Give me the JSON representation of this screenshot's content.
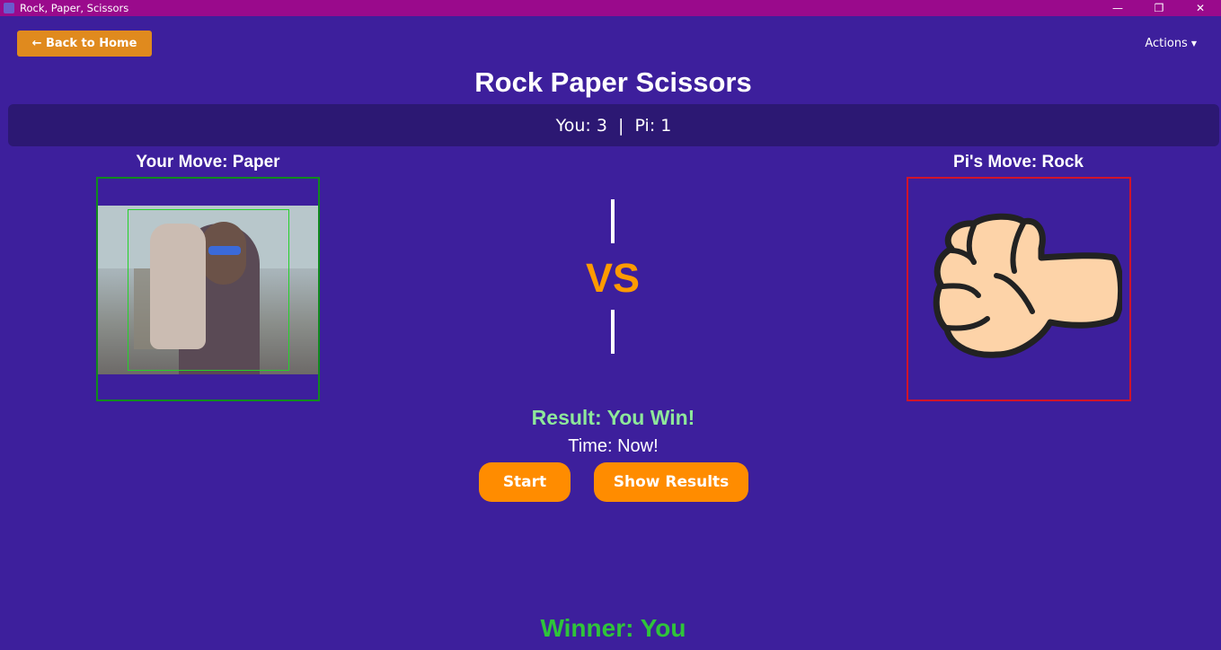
{
  "window": {
    "title": "Rock, Paper, Scissors",
    "controls": {
      "minimize": "—",
      "restore": "❐",
      "close": "✕"
    }
  },
  "header": {
    "back_label": "← Back to Home",
    "actions_label": "Actions",
    "actions_caret": "▼"
  },
  "page_title": "Rock Paper Scissors",
  "score": {
    "text": "You: 3  |  Pi: 1",
    "you": 3,
    "pi": 1
  },
  "player": {
    "move_label": "Your Move: Paper",
    "frame_color": "#118a1e"
  },
  "pi": {
    "move_label": "Pi's Move: Rock",
    "frame_color": "#d0142a"
  },
  "versus": "VS",
  "result": {
    "text": "Result: You Win!",
    "time": "Time: Now!"
  },
  "buttons": {
    "start": "Start",
    "show_results": "Show Results"
  },
  "winner": "Winner: You",
  "colors": {
    "background": "#3d1f9c",
    "titlebar": "#9a0a8c",
    "accent": "#ff8c00",
    "result": "#8ee89a",
    "winner": "#2fc43a"
  }
}
